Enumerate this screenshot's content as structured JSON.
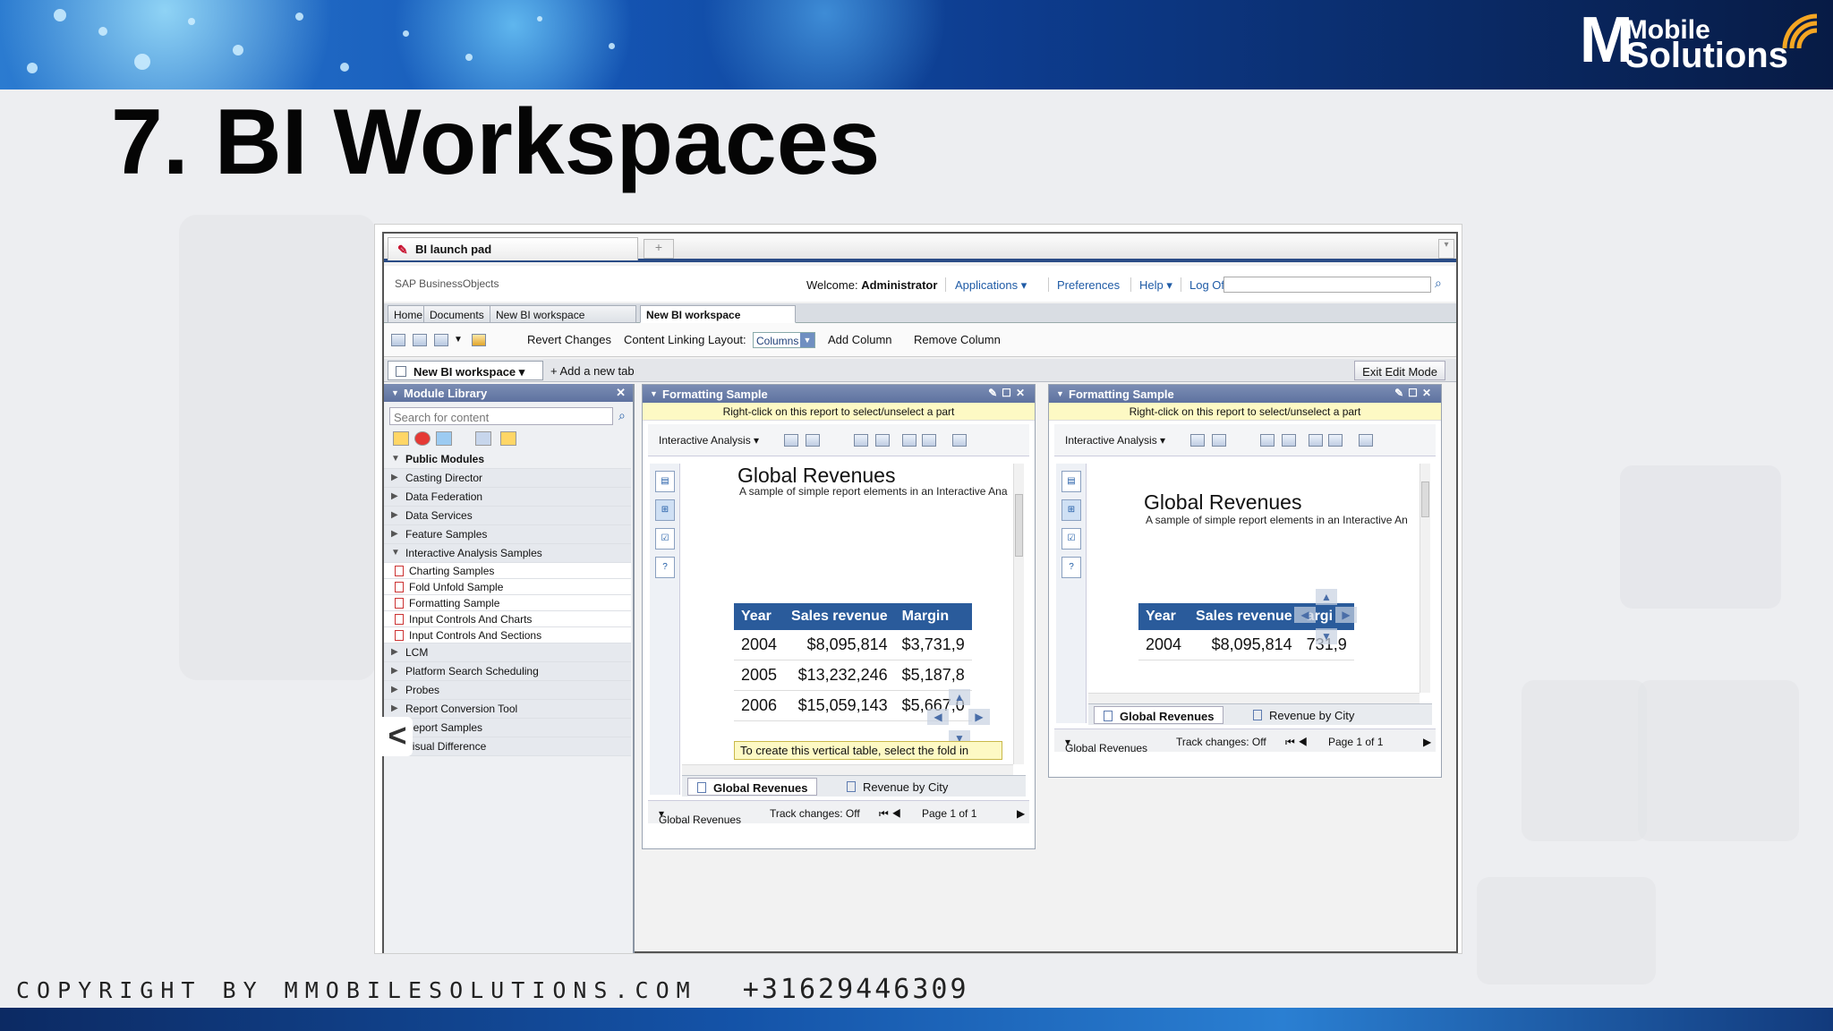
{
  "slide": {
    "title": "7. BI Workspaces",
    "logo_m": "M",
    "logo_line1": "Mobile",
    "logo_line2": "Solutions",
    "footer_copyright": "COPYRIGHT BY MMOBILESOLUTIONS.COM",
    "footer_phone": "+31629446309"
  },
  "browser": {
    "tab_title": "BI launch pad",
    "new_tab_symbol": "+"
  },
  "header": {
    "brand": "SAP BusinessObjects",
    "welcome_label": "Welcome:",
    "user": "Administrator",
    "links": [
      "Applications ▾",
      "Preferences",
      "Help ▾",
      "Log Off"
    ]
  },
  "nav_tabs": [
    "Home",
    "Documents",
    "New BI workspace",
    "New BI workspace"
  ],
  "toolbar": {
    "revert": "Revert Changes",
    "content_linking": "Content Linking",
    "layout_label": "Layout:",
    "layout_value": "Columns",
    "add_column": "Add Column",
    "remove_column": "Remove Column"
  },
  "workspace_tabs": {
    "active": "New BI workspace",
    "add": "+ Add a new tab",
    "exit": "Exit Edit Mode"
  },
  "module_library": {
    "title": "Module Library",
    "search_placeholder": "Search for content",
    "root": "Public Modules",
    "items": [
      "Casting Director",
      "Data Federation",
      "Data Services",
      "Feature Samples",
      "Interactive Analysis Samples"
    ],
    "sub_items": [
      "Charting Samples",
      "Fold Unfold Sample",
      "Formatting Sample",
      "Input Controls And Charts",
      "Input Controls And Sections"
    ],
    "items_after": [
      "LCM",
      "Platform Search Scheduling",
      "Probes",
      "Report Conversion Tool",
      "Report Samples",
      "Visual Difference"
    ]
  },
  "panel": {
    "title": "Formatting Sample",
    "hint": "Right-click on this report to select/unselect a part",
    "tool_label": "Interactive Analysis",
    "report_title": "Global Revenues",
    "report_sub": "A sample of simple report elements in an Interactive Ana",
    "table_headers": [
      "Year",
      "Sales revenue",
      "Margin"
    ],
    "rows": [
      [
        "2004",
        "$8,095,814",
        "$3,731,9"
      ],
      [
        "2005",
        "$13,232,246",
        "$5,187,8"
      ],
      [
        "2006",
        "$15,059,143",
        "$5,667,0"
      ]
    ],
    "tooltip": "To create this vertical table, select the fold in",
    "report_tabs": [
      "Global Revenues",
      "Revenue by City"
    ],
    "status_report": "Global Revenues",
    "status_track": "Track changes: Off",
    "status_page": "Page 1 of 1"
  },
  "panel2": {
    "title": "Formatting Sample",
    "hint": "Right-click on this report to select/unselect a part",
    "tool_label": "Interactive Analysis",
    "report_title": "Global Revenues",
    "report_sub": "A sample of simple report elements in an Interactive An",
    "table_headers": [
      "Year",
      "Sales revenue",
      "argi"
    ],
    "row": [
      "2004",
      "$8,095,814",
      "731,9"
    ],
    "report_tabs": [
      "Global Revenues",
      "Revenue by City"
    ],
    "status_report": "Global Revenues",
    "status_track": "Track changes: Off",
    "status_page": "Page 1 of 1"
  }
}
